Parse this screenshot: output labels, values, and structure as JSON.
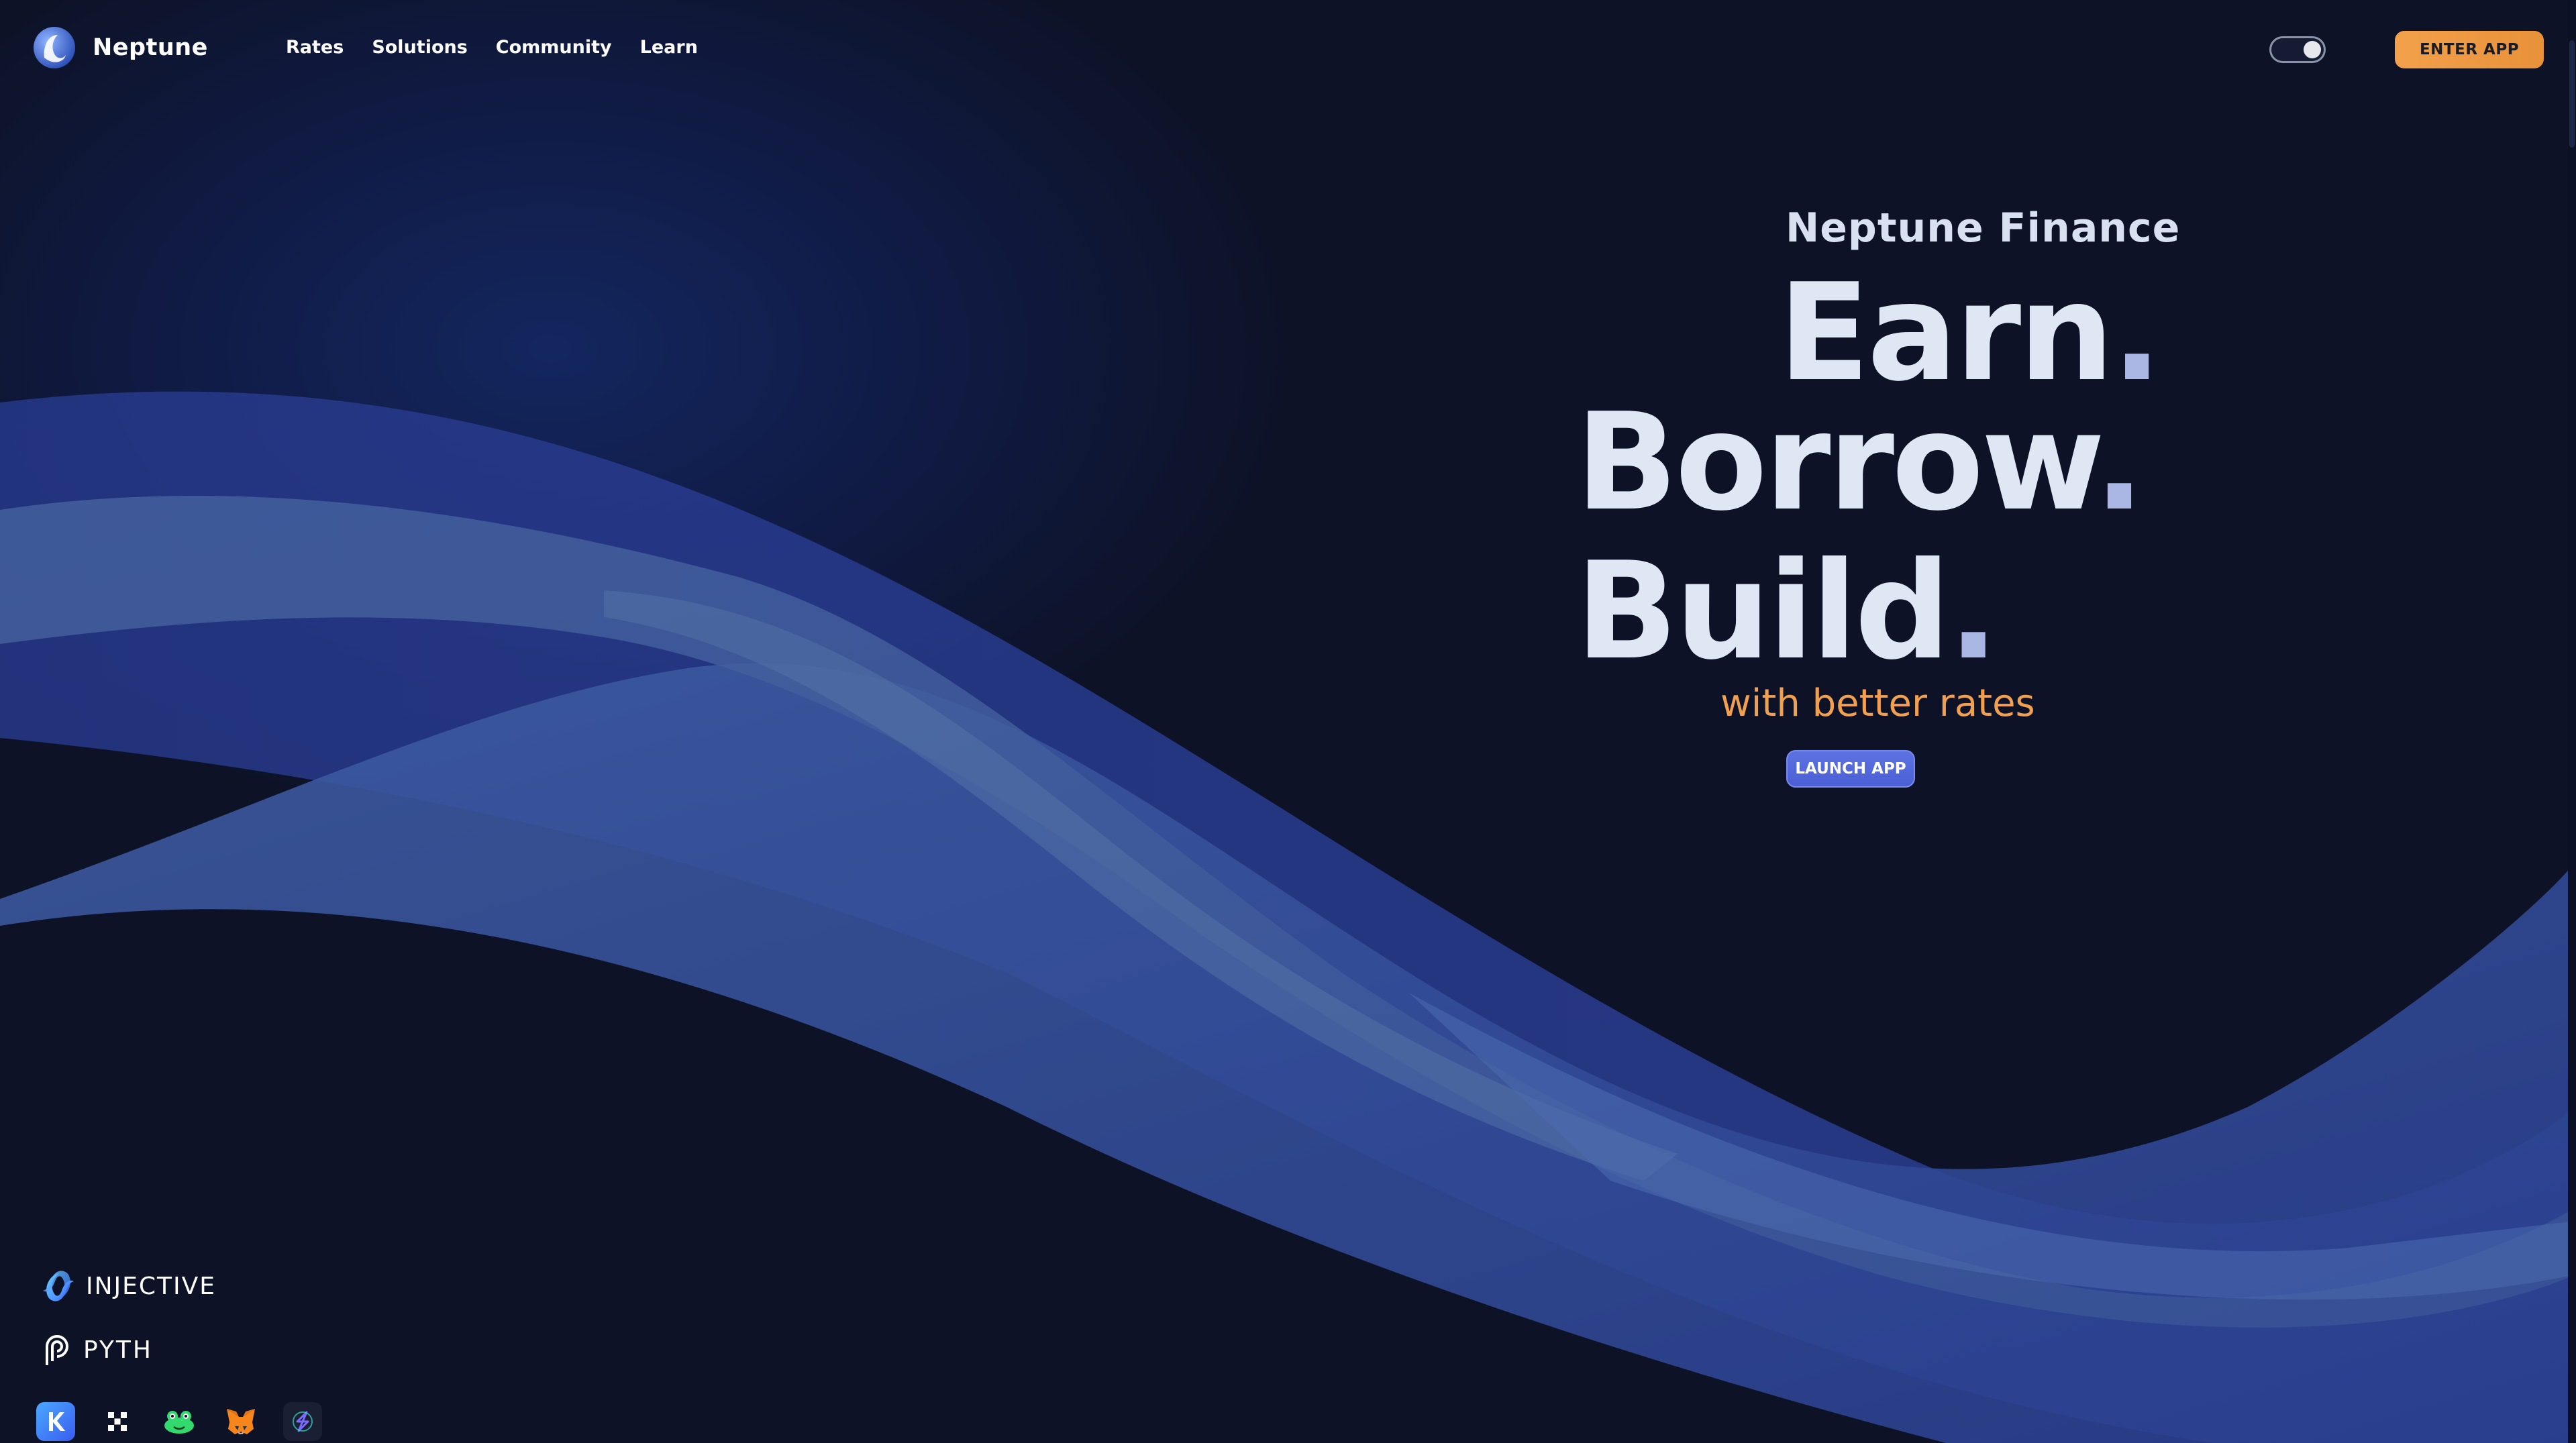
{
  "brand": {
    "name": "Neptune",
    "logo_icon": "neptune-logo-icon"
  },
  "nav": {
    "items": [
      {
        "label": "Rates"
      },
      {
        "label": "Solutions"
      },
      {
        "label": "Community"
      },
      {
        "label": "Learn"
      }
    ]
  },
  "header": {
    "theme_toggle_icon": "theme-toggle-icon",
    "enter_app_label": "ENTER APP"
  },
  "hero": {
    "subtitle": "Neptune Finance",
    "line1": "Earn",
    "line2": "Borrow",
    "line3": "Build",
    "dot": ".",
    "tagline": "with better rates",
    "launch_label": "LAUNCH APP"
  },
  "partners": {
    "injective": {
      "label": "INJECTIVE",
      "icon": "injective-icon"
    },
    "pyth": {
      "label": "PYTH",
      "icon": "pyth-icon"
    }
  },
  "wallets": [
    {
      "icon": "keplr-icon"
    },
    {
      "icon": "okx-icon"
    },
    {
      "icon": "leap-icon"
    },
    {
      "icon": "metamask-icon"
    },
    {
      "icon": "ninji-icon"
    }
  ],
  "colors": {
    "background": "#0d1226",
    "accent_orange": "#f0a050",
    "accent_blue": "#5d72e2",
    "hero_text": "#dfe6f4"
  }
}
